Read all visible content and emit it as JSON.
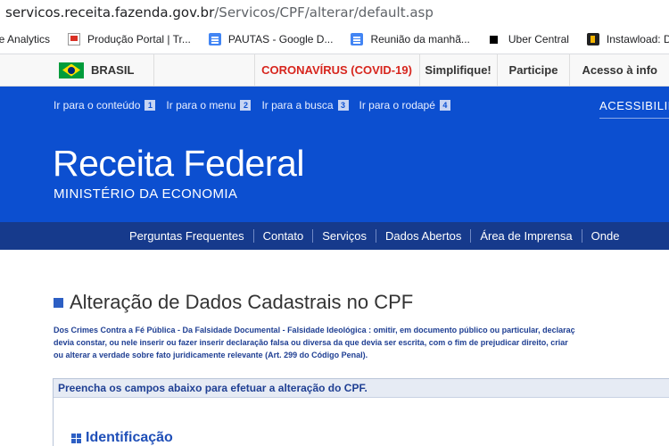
{
  "browser": {
    "url_host": "servicos.receita.fazenda.gov.br",
    "url_path": "/Servicos/CPF/alterar/default.asp",
    "bookmarks": [
      {
        "label": "le Analytics",
        "icon": "analytics-icon"
      },
      {
        "label": "Produção Portal | Tr...",
        "icon": "portal-icon"
      },
      {
        "label": "PAUTAS - Google D...",
        "icon": "google-docs-icon"
      },
      {
        "label": "Reunião da manhã...",
        "icon": "google-docs-icon"
      },
      {
        "label": "Uber Central",
        "icon": "uber-icon"
      },
      {
        "label": "Instawload: Do",
        "icon": "instawload-icon"
      }
    ]
  },
  "govbar": {
    "brasil": "BRASIL",
    "covid": "CORONAVÍRUS (COVID-19)",
    "simplifique": "Simplifique!",
    "participe": "Participe",
    "acesso": "Acesso à info"
  },
  "header": {
    "skip_links": [
      {
        "label": "Ir para o conteúdo",
        "key": "1"
      },
      {
        "label": "Ir para o menu",
        "key": "2"
      },
      {
        "label": "Ir para a busca",
        "key": "3"
      },
      {
        "label": "Ir para o rodapé",
        "key": "4"
      }
    ],
    "accessibility": "ACESSIBILIDADE",
    "title": "Receita Federal",
    "subtitle": "MINISTÉRIO DA ECONOMIA"
  },
  "menu": [
    "Perguntas Frequentes",
    "Contato",
    "Serviços",
    "Dados Abertos",
    "Área de Imprensa",
    "Onde"
  ],
  "main": {
    "page_title": "Alteração de Dados Cadastrais no CPF",
    "legal_lines": [
      "Dos Crimes Contra a Fé Pública - Da Falsidade Documental - Falsidade Ideológica : omitir, em documento público ou particular, declaraç",
      "devia constar, ou nele inserir ou fazer inserir declaração falsa ou diversa da que devia ser escrita, com o fim de prejudicar direito, criar",
      "ou alterar a verdade sobre fato juridicamente relevante (Art. 299 do Código Penal)."
    ],
    "form_hint": "Preencha os campos abaixo para efetuar a alteração do CPF.",
    "section_title": "Identificação"
  },
  "colors": {
    "header_blue": "#0c4fd0",
    "menu_blue": "#163a8c",
    "covid_red": "#d7261e"
  }
}
